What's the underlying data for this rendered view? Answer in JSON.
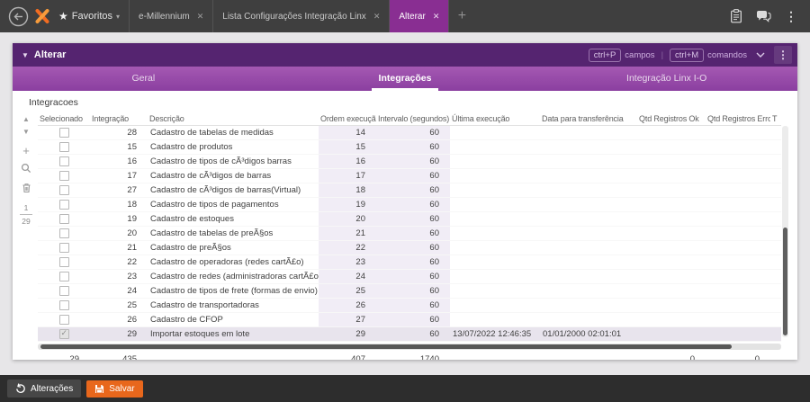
{
  "topbar": {
    "favorites": {
      "label": "Favoritos"
    },
    "tabs": [
      {
        "label": "e-Millennium",
        "active": false
      },
      {
        "label": "Lista Configurações Integração Linx",
        "active": false
      },
      {
        "label": "Alterar",
        "active": true
      }
    ]
  },
  "icons": {
    "star": "★",
    "caret_down": "▾",
    "close": "✕",
    "add_tab": "+",
    "kebab": "⋮",
    "collapse": "▼",
    "scroll_up": "▲",
    "scroll_down": "▼",
    "add_row": "+"
  },
  "panel": {
    "title": "Alterar",
    "shortcuts": {
      "campos_key": "ctrl+P",
      "campos_label": "campos",
      "separator": "|",
      "comandos_key": "ctrl+M",
      "comandos_label": "comandos"
    },
    "tabs": [
      {
        "label": "Geral",
        "active": false
      },
      {
        "label": "Integrações",
        "active": true
      },
      {
        "label": "Integração Linx I-O",
        "active": false
      }
    ]
  },
  "section_label": "Integracoes",
  "table": {
    "columns": [
      "Selecionado",
      "Integração",
      "Descrição",
      "Ordem execução",
      "Intervalo (segundos)",
      "Última execução",
      "Data para transferência",
      "Qtd Registros Ok",
      "Qtd Registros Erro",
      "T"
    ],
    "rows": [
      {
        "checked": false,
        "selected": false,
        "integracao": "28",
        "descricao": "Cadastro de tabelas de medidas",
        "ordem": "14",
        "intervalo": "60",
        "ultima_execucao": "",
        "data_transferencia": "",
        "qtd_ok": "",
        "qtd_erro": ""
      },
      {
        "checked": false,
        "selected": false,
        "integracao": "15",
        "descricao": "Cadastro de produtos",
        "ordem": "15",
        "intervalo": "60",
        "ultima_execucao": "",
        "data_transferencia": "",
        "qtd_ok": "",
        "qtd_erro": ""
      },
      {
        "checked": false,
        "selected": false,
        "integracao": "16",
        "descricao": "Cadastro de tipos de cÃ³digos barras",
        "ordem": "16",
        "intervalo": "60",
        "ultima_execucao": "",
        "data_transferencia": "",
        "qtd_ok": "",
        "qtd_erro": ""
      },
      {
        "checked": false,
        "selected": false,
        "integracao": "17",
        "descricao": "Cadastro de cÃ³digos de barras",
        "ordem": "17",
        "intervalo": "60",
        "ultima_execucao": "",
        "data_transferencia": "",
        "qtd_ok": "",
        "qtd_erro": ""
      },
      {
        "checked": false,
        "selected": false,
        "integracao": "27",
        "descricao": "Cadastro de cÃ³digos de barras(Virtual)",
        "ordem": "18",
        "intervalo": "60",
        "ultima_execucao": "",
        "data_transferencia": "",
        "qtd_ok": "",
        "qtd_erro": ""
      },
      {
        "checked": false,
        "selected": false,
        "integracao": "18",
        "descricao": "Cadastro de tipos de pagamentos",
        "ordem": "19",
        "intervalo": "60",
        "ultima_execucao": "",
        "data_transferencia": "",
        "qtd_ok": "",
        "qtd_erro": ""
      },
      {
        "checked": false,
        "selected": false,
        "integracao": "19",
        "descricao": "Cadastro de estoques",
        "ordem": "20",
        "intervalo": "60",
        "ultima_execucao": "",
        "data_transferencia": "",
        "qtd_ok": "",
        "qtd_erro": ""
      },
      {
        "checked": false,
        "selected": false,
        "integracao": "20",
        "descricao": "Cadastro de tabelas de preÃ§os",
        "ordem": "21",
        "intervalo": "60",
        "ultima_execucao": "",
        "data_transferencia": "",
        "qtd_ok": "",
        "qtd_erro": ""
      },
      {
        "checked": false,
        "selected": false,
        "integracao": "21",
        "descricao": "Cadastro de preÃ§os",
        "ordem": "22",
        "intervalo": "60",
        "ultima_execucao": "",
        "data_transferencia": "",
        "qtd_ok": "",
        "qtd_erro": ""
      },
      {
        "checked": false,
        "selected": false,
        "integracao": "22",
        "descricao": "Cadastro de operadoras (redes cartÃ£o)",
        "ordem": "23",
        "intervalo": "60",
        "ultima_execucao": "",
        "data_transferencia": "",
        "qtd_ok": "",
        "qtd_erro": ""
      },
      {
        "checked": false,
        "selected": false,
        "integracao": "23",
        "descricao": "Cadastro de redes (administradoras cartÃ£o)",
        "ordem": "24",
        "intervalo": "60",
        "ultima_execucao": "",
        "data_transferencia": "",
        "qtd_ok": "",
        "qtd_erro": ""
      },
      {
        "checked": false,
        "selected": false,
        "integracao": "24",
        "descricao": "Cadastro de tipos de frete (formas de envio)",
        "ordem": "25",
        "intervalo": "60",
        "ultima_execucao": "",
        "data_transferencia": "",
        "qtd_ok": "",
        "qtd_erro": ""
      },
      {
        "checked": false,
        "selected": false,
        "integracao": "25",
        "descricao": "Cadastro de transportadoras",
        "ordem": "26",
        "intervalo": "60",
        "ultima_execucao": "",
        "data_transferencia": "",
        "qtd_ok": "",
        "qtd_erro": ""
      },
      {
        "checked": false,
        "selected": false,
        "integracao": "26",
        "descricao": "Cadastro de CFOP",
        "ordem": "27",
        "intervalo": "60",
        "ultima_execucao": "",
        "data_transferencia": "",
        "qtd_ok": "",
        "qtd_erro": ""
      },
      {
        "checked": true,
        "selected": true,
        "integracao": "29",
        "descricao": "Importar estoques em lote",
        "ordem": "29",
        "intervalo": "60",
        "ultima_execucao": "13/07/2022 12:46:35",
        "data_transferencia": "01/01/2000 02:01:01",
        "qtd_ok": "",
        "qtd_erro": ""
      }
    ],
    "totals": {
      "selecionado": "29",
      "integracao": "435",
      "ordem": "407",
      "intervalo": "1740",
      "qtd_ok": "0",
      "qtd_erro": "0"
    },
    "pager": {
      "current": "1",
      "total": "29"
    }
  },
  "footer": {
    "alteracoes_label": "Alterações",
    "salvar_label": "Salvar"
  },
  "colors": {
    "active_tab_purple": "#892e92",
    "panel_header_purple": "#552470",
    "tabstrip_purple": "#8b3fa0",
    "salvar_orange": "#e8671c",
    "linx_orange": "#f26c21",
    "shaded_column": "#f1edf6"
  }
}
